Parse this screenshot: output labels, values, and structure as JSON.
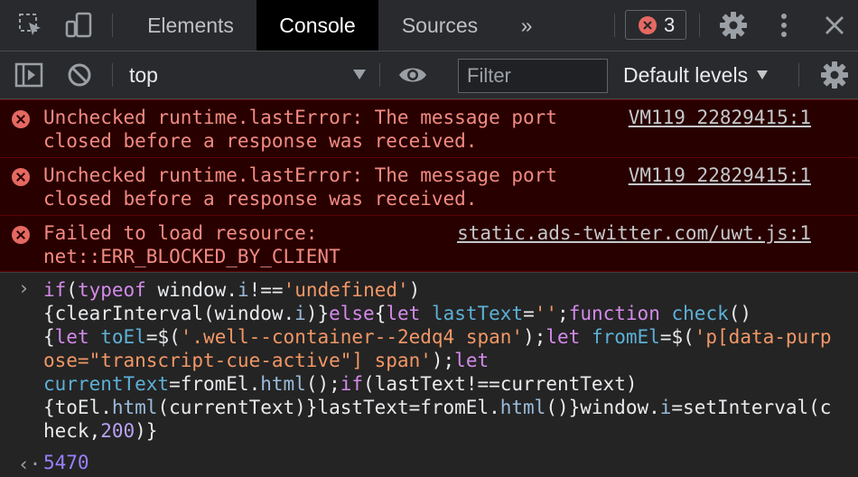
{
  "tabs": [
    "Elements",
    "Console",
    "Sources"
  ],
  "active_tab": "Console",
  "more_tabs": "»",
  "error_count": "3",
  "toolbar": {
    "context": "top",
    "filter_placeholder": "Filter",
    "levels": "Default levels"
  },
  "messages": [
    {
      "line1": "Unchecked runtime.lastError: The message port",
      "line2": "closed before a response was received.",
      "source": "VM119 22829415:1"
    },
    {
      "line1": "Unchecked runtime.lastError: The message port",
      "line2": "closed before a response was received.",
      "source": "VM119 22829415:1"
    },
    {
      "line1": "Failed to load resource:",
      "line2": "net::ERR_BLOCKED_BY_CLIENT",
      "source": "static.ads-twitter.com/uwt.js:1"
    }
  ],
  "input_prompt": "›",
  "code": [
    {
      "t": "kw",
      "v": "if"
    },
    {
      "t": "p",
      "v": "("
    },
    {
      "t": "kw",
      "v": "typeof"
    },
    {
      "t": "p",
      "v": " window."
    },
    {
      "t": "prop",
      "v": "i"
    },
    {
      "t": "p",
      "v": "!=="
    },
    {
      "t": "str",
      "v": "'undefined'"
    },
    {
      "t": "p",
      "v": ")\n{clearInterval(window."
    },
    {
      "t": "prop",
      "v": "i"
    },
    {
      "t": "p",
      "v": ")}"
    },
    {
      "t": "kw",
      "v": "else"
    },
    {
      "t": "p",
      "v": "{"
    },
    {
      "t": "kw",
      "v": "let"
    },
    {
      "t": "p",
      "v": " "
    },
    {
      "t": "var",
      "v": "lastText"
    },
    {
      "t": "p",
      "v": "="
    },
    {
      "t": "str",
      "v": "''"
    },
    {
      "t": "p",
      "v": ";"
    },
    {
      "t": "kw",
      "v": "function"
    },
    {
      "t": "p",
      "v": " "
    },
    {
      "t": "var",
      "v": "check"
    },
    {
      "t": "p",
      "v": "()\n{"
    },
    {
      "t": "kw",
      "v": "let"
    },
    {
      "t": "p",
      "v": " "
    },
    {
      "t": "var",
      "v": "toEl"
    },
    {
      "t": "p",
      "v": "=$("
    },
    {
      "t": "str",
      "v": "'.well--container--2edq4 span'"
    },
    {
      "t": "p",
      "v": ");"
    },
    {
      "t": "kw",
      "v": "let"
    },
    {
      "t": "p",
      "v": " "
    },
    {
      "t": "var",
      "v": "fromEl"
    },
    {
      "t": "p",
      "v": "=$("
    },
    {
      "t": "str",
      "v": "'p[data-purpose=\"transcript-cue-active\"] span'"
    },
    {
      "t": "p",
      "v": ");"
    },
    {
      "t": "kw",
      "v": "let"
    },
    {
      "t": "p",
      "v": "\n"
    },
    {
      "t": "var",
      "v": "currentText"
    },
    {
      "t": "p",
      "v": "=fromEl."
    },
    {
      "t": "prop",
      "v": "html"
    },
    {
      "t": "p",
      "v": "();"
    },
    {
      "t": "kw",
      "v": "if"
    },
    {
      "t": "p",
      "v": "(lastText!==currentText)\n{toEl."
    },
    {
      "t": "prop",
      "v": "html"
    },
    {
      "t": "p",
      "v": "(currentText)}lastText=fromEl."
    },
    {
      "t": "prop",
      "v": "html"
    },
    {
      "t": "p",
      "v": "()}window."
    },
    {
      "t": "prop",
      "v": "i"
    },
    {
      "t": "p",
      "v": "=setInterval(check,"
    },
    {
      "t": "num",
      "v": "200"
    },
    {
      "t": "p",
      "v": ")}"
    }
  ],
  "result_prompt": "‹·",
  "result_value": "5470",
  "icons": [
    "inspect-icon",
    "device-toggle-icon",
    "error-icon",
    "settings-icon",
    "kebab-menu-icon",
    "close-icon",
    "sidebar-toggle-icon",
    "clear-console-icon",
    "eye-icon",
    "console-settings-icon"
  ],
  "colors": {
    "error_bg": "#290000",
    "error_text": "#f28b82",
    "keyword": "#d38aea",
    "string": "#f29766",
    "result": "#9980ff"
  }
}
